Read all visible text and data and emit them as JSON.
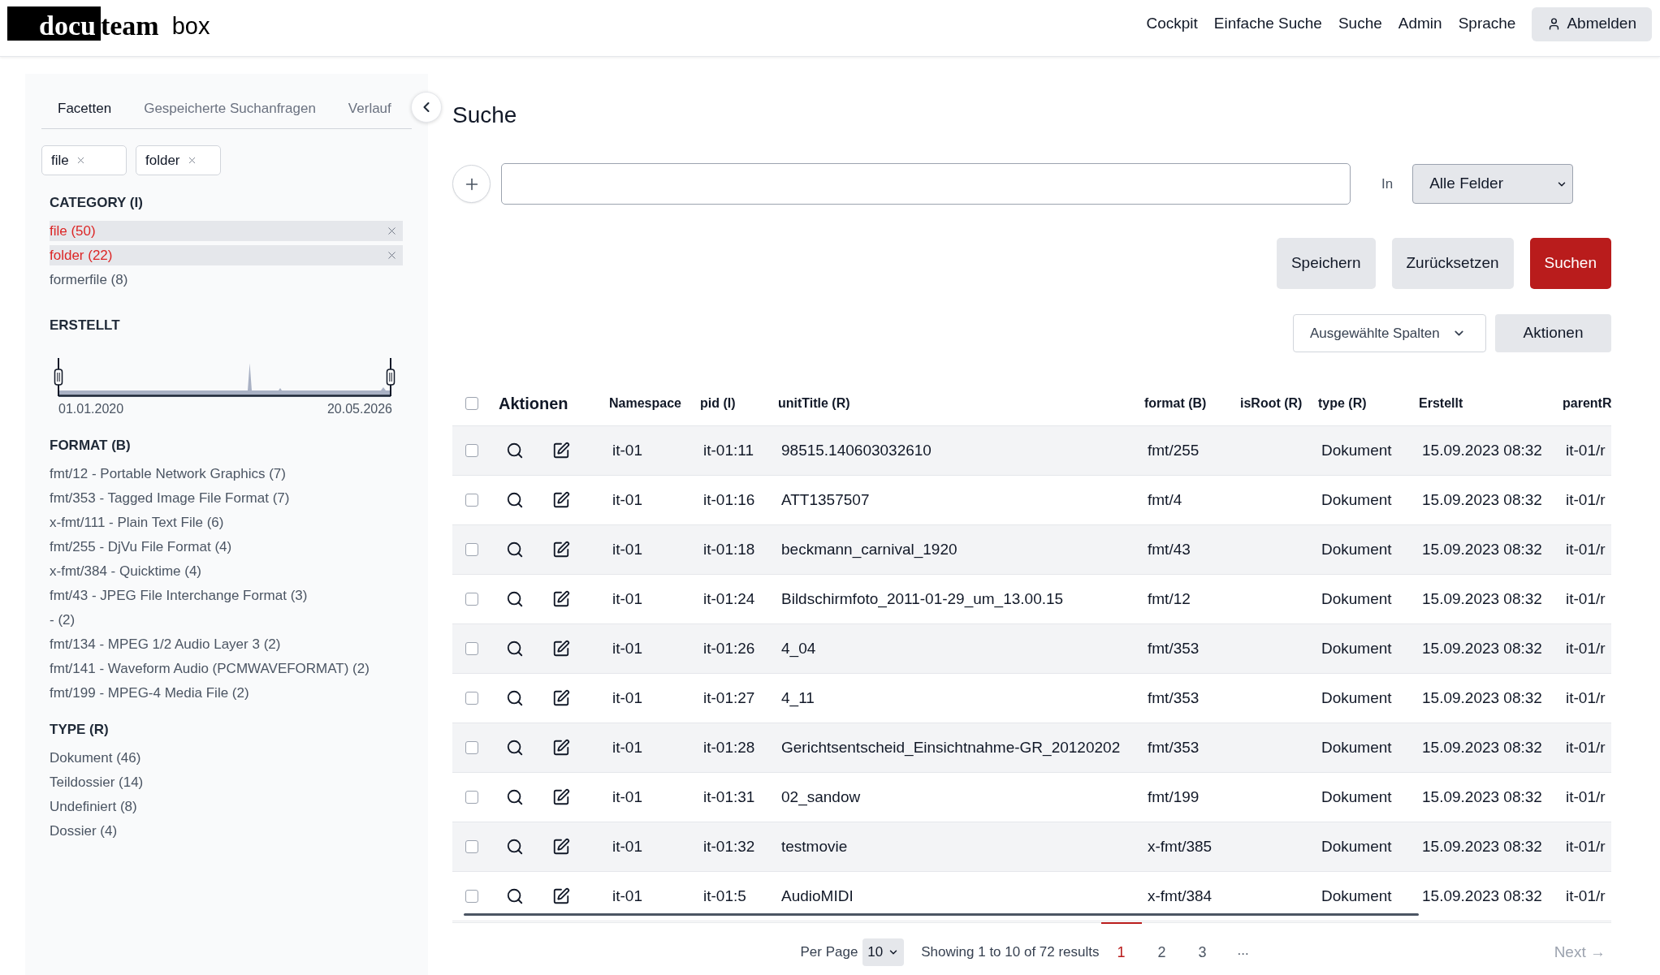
{
  "header": {
    "logo": {
      "highlighted": "docu",
      "plain": "team",
      "product": "box"
    },
    "nav": [
      "Cockpit",
      "Einfache Suche",
      "Suche",
      "Admin",
      "Sprache"
    ],
    "logout_button": "Abmelden"
  },
  "sidebar": {
    "tabs": [
      {
        "label": "Facetten",
        "selected": true
      },
      {
        "label": "Gespeicherte Suchanfragen",
        "selected": false
      },
      {
        "label": "Verlauf",
        "selected": false
      }
    ],
    "active_filters": [
      "file",
      "folder"
    ],
    "facets": [
      {
        "kind": "list",
        "title": "CATEGORY (I)",
        "items": [
          {
            "label": "file (50)",
            "selected": true
          },
          {
            "label": "folder (22)",
            "selected": true
          },
          {
            "label": "formerfile (8)",
            "selected": false
          }
        ]
      },
      {
        "kind": "range",
        "title": "ERSTELLT",
        "start_label": "01.01.2020",
        "end_label": "20.05.2026",
        "handles": [
          {
            "level": 0
          },
          {
            "level": 1
          }
        ]
      },
      {
        "kind": "list",
        "title": "FORMAT (B)",
        "items": [
          {
            "label": "fmt/12 - Portable Network Graphics (7)",
            "selected": false
          },
          {
            "label": "fmt/353 - Tagged Image File Format (7)",
            "selected": false
          },
          {
            "label": "x-fmt/111 - Plain Text File (6)",
            "selected": false
          },
          {
            "label": "fmt/255 - DjVu File Format (4)",
            "selected": false
          },
          {
            "label": "x-fmt/384 - Quicktime (4)",
            "selected": false
          },
          {
            "label": "fmt/43 - JPEG File Interchange Format (3)",
            "selected": false
          },
          {
            "label": "- (2)",
            "selected": false
          },
          {
            "label": "fmt/134 - MPEG 1/2 Audio Layer 3 (2)",
            "selected": false
          },
          {
            "label": "fmt/141 - Waveform Audio (PCMWAVEFORMAT) (2)",
            "selected": false
          },
          {
            "label": "fmt/199 - MPEG-4 Media File (2)",
            "selected": false
          }
        ]
      },
      {
        "kind": "list",
        "title": "TYPE (R)",
        "items": [
          {
            "label": "Dokument (46)",
            "selected": false
          },
          {
            "label": "Teildossier (14)",
            "selected": false
          },
          {
            "label": "Undefiniert (8)",
            "selected": false
          },
          {
            "label": "Dossier (4)",
            "selected": false
          }
        ]
      }
    ]
  },
  "main": {
    "title": "Suche",
    "search": {
      "scope_label": "In",
      "scope_value": "Alle Felder"
    },
    "buttons": [
      {
        "label": "Speichern",
        "kind": "secondary"
      },
      {
        "label": "Zurücksetzen",
        "kind": "secondary"
      },
      {
        "label": "Suchen",
        "kind": "primary"
      }
    ],
    "columns_dropdown": "Ausgewählte Spalten",
    "actions_button": "Aktionen",
    "table": {
      "all_checked": false,
      "columns": [
        {
          "label": "Aktionen",
          "kind": "actions"
        },
        {
          "label": "Namespace",
          "kind": "text"
        },
        {
          "label": "pid (I)",
          "kind": "text"
        },
        {
          "label": "unitTitle (R)",
          "kind": "text"
        },
        {
          "label": "format (B)",
          "kind": "text"
        },
        {
          "label": "isRoot (R)",
          "kind": "text"
        },
        {
          "label": "type (R)",
          "kind": "text"
        },
        {
          "label": "Erstellt",
          "kind": "text"
        },
        {
          "label": "parentR",
          "kind": "text"
        }
      ],
      "rows": [
        {
          "checked": false,
          "namespace": "it-01",
          "pid": "it-01:11",
          "unit_title": "98515.140603032610",
          "format": "fmt/255",
          "type": "Dokument",
          "created": "15.09.2023 08:32",
          "parent": "it-01/r"
        },
        {
          "checked": false,
          "namespace": "it-01",
          "pid": "it-01:16",
          "unit_title": "ATT1357507",
          "format": "fmt/4",
          "type": "Dokument",
          "created": "15.09.2023 08:32",
          "parent": "it-01/r"
        },
        {
          "checked": false,
          "namespace": "it-01",
          "pid": "it-01:18",
          "unit_title": "beckmann_carnival_1920",
          "format": "fmt/43",
          "type": "Dokument",
          "created": "15.09.2023 08:32",
          "parent": "it-01/r"
        },
        {
          "checked": false,
          "namespace": "it-01",
          "pid": "it-01:24",
          "unit_title": "Bildschirmfoto_2011-01-29_um_13.00.15",
          "format": "fmt/12",
          "type": "Dokument",
          "created": "15.09.2023 08:32",
          "parent": "it-01/r"
        },
        {
          "checked": false,
          "namespace": "it-01",
          "pid": "it-01:26",
          "unit_title": "4_04",
          "format": "fmt/353",
          "type": "Dokument",
          "created": "15.09.2023 08:32",
          "parent": "it-01/r"
        },
        {
          "checked": false,
          "namespace": "it-01",
          "pid": "it-01:27",
          "unit_title": "4_11",
          "format": "fmt/353",
          "type": "Dokument",
          "created": "15.09.2023 08:32",
          "parent": "it-01/r"
        },
        {
          "checked": false,
          "namespace": "it-01",
          "pid": "it-01:28",
          "unit_title": "Gerichtsentscheid_Einsichtnahme-GR_20120202",
          "format": "fmt/353",
          "type": "Dokument",
          "created": "15.09.2023 08:32",
          "parent": "it-01/r"
        },
        {
          "checked": false,
          "namespace": "it-01",
          "pid": "it-01:31",
          "unit_title": "02_sandow",
          "format": "fmt/199",
          "type": "Dokument",
          "created": "15.09.2023 08:32",
          "parent": "it-01/r"
        },
        {
          "checked": false,
          "namespace": "it-01",
          "pid": "it-01:32",
          "unit_title": "testmovie",
          "format": "x-fmt/385",
          "type": "Dokument",
          "created": "15.09.2023 08:32",
          "parent": "it-01/r"
        },
        {
          "checked": false,
          "namespace": "it-01",
          "pid": "it-01:5",
          "unit_title": "AudioMIDI",
          "format": "x-fmt/384",
          "type": "Dokument",
          "created": "15.09.2023 08:32",
          "parent": "it-01/r"
        }
      ]
    },
    "pagination": {
      "per_page_label": "Per Page",
      "per_page_value": "10",
      "summary": "Showing 1 to 10 of 72 results",
      "pages": [
        {
          "label": "1",
          "selected": true
        },
        {
          "label": "2",
          "selected": false
        },
        {
          "label": "3",
          "selected": false
        }
      ],
      "ellipsis": "...",
      "next": "Next →"
    }
  }
}
